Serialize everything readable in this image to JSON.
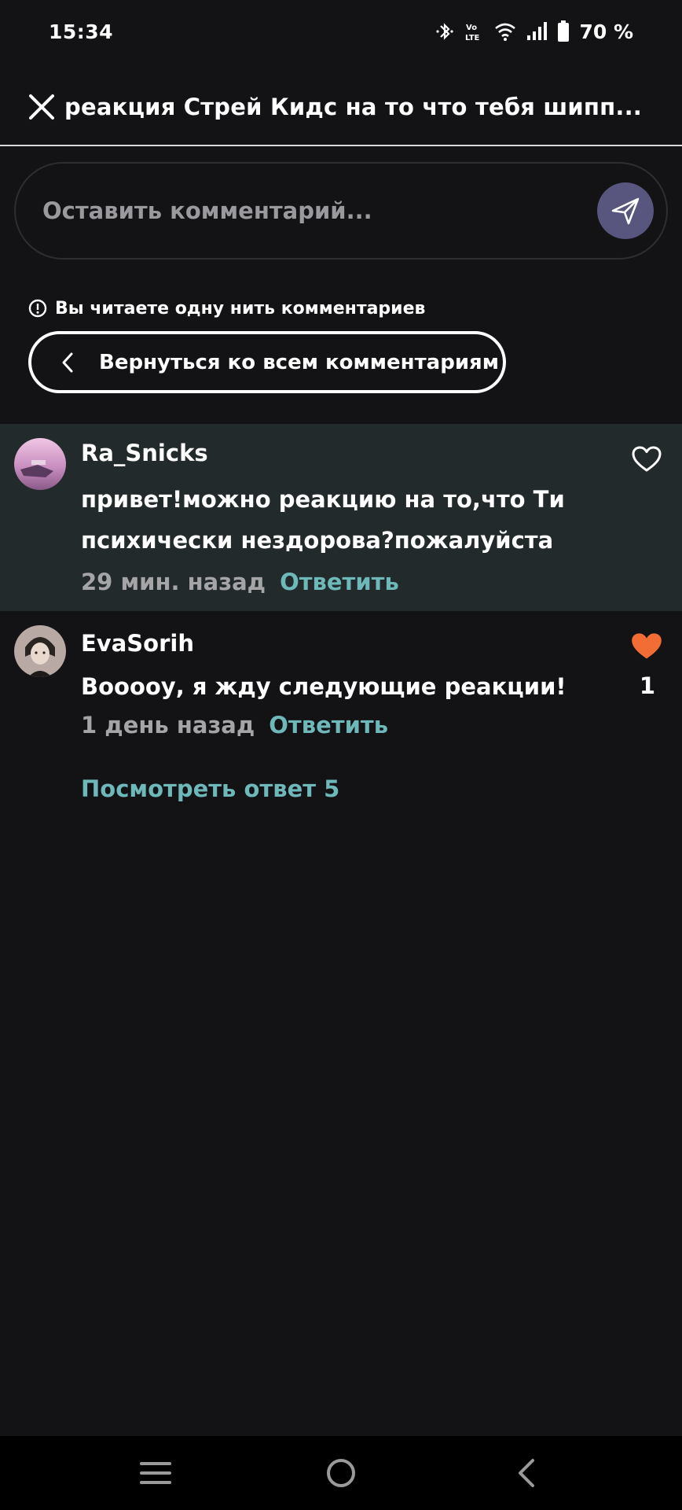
{
  "status_bar": {
    "time": "15:34",
    "battery": "70 %",
    "icons": [
      "bluetooth-icon",
      "volte-icon",
      "wifi-icon",
      "signal-icon",
      "battery-icon"
    ]
  },
  "header": {
    "title": "реакция Стрей Кидс на то что тебя шипп..."
  },
  "comment_box": {
    "placeholder": "Оставить комментарий...",
    "send_color": "#58557e"
  },
  "thread": {
    "notice": "Вы читаете одну нить комментариев",
    "back_label": "Вернуться ко всем комментариям"
  },
  "comments": [
    {
      "author": "Ra_Snicks",
      "text": "привет!можно реакцию на то,что Ти психически нездорова?пожалуйста",
      "time": "29 мин. назад",
      "reply": "Ответить",
      "liked": false,
      "likes": ""
    },
    {
      "author": "EvaSorih",
      "text": "Вооооу, я жду следующие реакции!",
      "time": "1 день назад",
      "reply": "Ответить",
      "liked": true,
      "likes": "1"
    }
  ],
  "view_replies": "Посмотреть ответ 5",
  "colors": {
    "background": "#131215",
    "highlight": "#222a2c",
    "accent": "#6eb8ba",
    "heart_liked": "#f26d35"
  }
}
